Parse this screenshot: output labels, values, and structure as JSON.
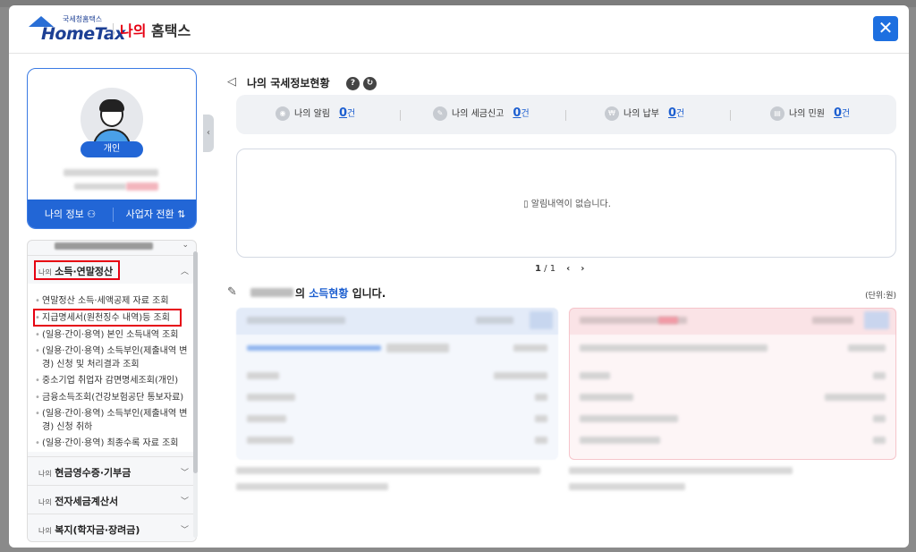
{
  "header": {
    "logo_small": "국세청홈택스",
    "logo_main": "HomeTax",
    "title_accent": "나의",
    "title_rest": " 홈택스",
    "close_icon": "close-icon"
  },
  "profile": {
    "type_badge": "개인",
    "my_info": "나의 정보",
    "switch_business": "사업자 전환"
  },
  "menu": {
    "sections": [
      {
        "small": "나의",
        "big": "소득·연말정산"
      },
      {
        "small": "나의",
        "big": "현금영수증·기부금"
      },
      {
        "small": "나의",
        "big": "전자세금계산서"
      },
      {
        "small": "나의",
        "big": "복지(학자금·장려금)"
      }
    ],
    "items": [
      "연말정산 소득·세액공제 자료 조회",
      "지급명세서(원천징수 내역)등 조회",
      "(일용·간이·용역) 본인 소득내역 조회",
      "(일용·간이·용역) 소득부인(제출내역 변경) 신청 및 처리결과 조회",
      "중소기업 취업자 감면명세조회(개인)",
      "금융소득조회(건강보험공단 통보자료)",
      "(일용·간이·용역) 소득부인(제출내역 변경) 신청 취하",
      "(일용·간이·용역) 최종수록 자료 조회"
    ]
  },
  "status": {
    "title": "나의 국세정보현황",
    "help_label": "?",
    "items": [
      {
        "label": "나의 알림",
        "count": "0",
        "unit": "건"
      },
      {
        "label": "나의 세금신고",
        "count": "0",
        "unit": "건"
      },
      {
        "label": "나의 납부",
        "count": "0",
        "unit": "건"
      },
      {
        "label": "나의 민원",
        "count": "0",
        "unit": "건"
      }
    ]
  },
  "notice": {
    "empty_text": "알림내역이 없습니다.",
    "page_current": "1",
    "page_total": "1"
  },
  "income": {
    "title_mid": "의 ",
    "title_link": "소득현황",
    "title_end": " 입니다.",
    "unit": "(단위:원)"
  }
}
